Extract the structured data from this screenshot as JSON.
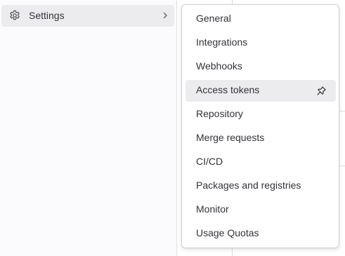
{
  "sidebar": {
    "settings_item": {
      "label": "Settings",
      "icon": "gear-icon",
      "chevron": "chevron-right-icon"
    }
  },
  "flyout": {
    "items": [
      {
        "label": "General"
      },
      {
        "label": "Integrations"
      },
      {
        "label": "Webhooks"
      },
      {
        "label": "Access tokens",
        "active": true,
        "icon": "pin-icon"
      },
      {
        "label": "Repository"
      },
      {
        "label": "Merge requests"
      },
      {
        "label": "CI/CD"
      },
      {
        "label": "Packages and registries"
      },
      {
        "label": "Monitor"
      },
      {
        "label": "Usage Quotas"
      }
    ]
  },
  "colors": {
    "sidebar_bg": "#fbfafd",
    "active_bg": "#ececef",
    "text": "#333238",
    "link": "#1f75cb"
  }
}
